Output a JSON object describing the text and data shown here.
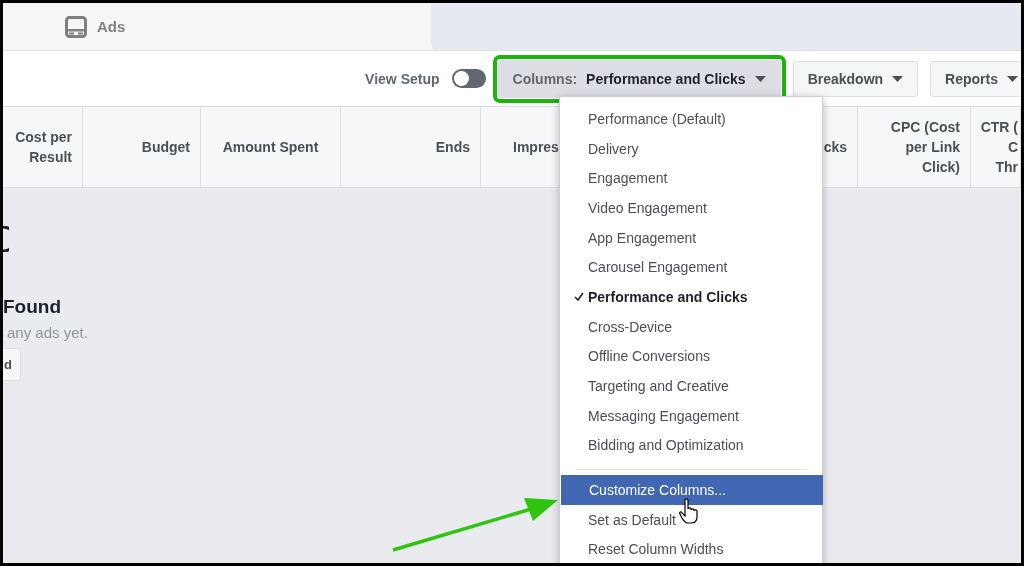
{
  "tab": {
    "label": "Ads"
  },
  "toolbar": {
    "view_setup": {
      "label": "View Setup",
      "on": false
    },
    "columns_button": {
      "label": "Columns: **Performance and Clicks**",
      "highlighted": true
    },
    "buttons": [
      "Breakdown",
      "Reports"
    ]
  },
  "table": {
    "columns": [
      {
        "label": "Cost per\nResult"
      },
      {
        "label": "Budget"
      },
      {
        "label": "Amount Spent"
      },
      {
        "label": "Ends"
      },
      {
        "label": "Impres"
      },
      {
        "label": "cks"
      },
      {
        "label": "CPC (Cost\nper Link\nClick)"
      },
      {
        "label": "CTR (\nC\nThr"
      }
    ]
  },
  "empty_state": {
    "title": "Found",
    "message": "any ads yet.",
    "button": "d"
  },
  "columns_menu": {
    "presets": [
      {
        "label": "Performance (Default)",
        "selected": false
      },
      {
        "label": "Delivery",
        "selected": false
      },
      {
        "label": "Engagement",
        "selected": false
      },
      {
        "label": "Video Engagement",
        "selected": false
      },
      {
        "label": "App Engagement",
        "selected": false
      },
      {
        "label": "Carousel Engagement",
        "selected": false
      },
      {
        "label": "Performance and Clicks",
        "selected": true
      },
      {
        "label": "Cross-Device",
        "selected": false
      },
      {
        "label": "Offline Conversions",
        "selected": false
      },
      {
        "label": "Targeting and Creative",
        "selected": false
      },
      {
        "label": "Messaging Engagement",
        "selected": false
      },
      {
        "label": "Bidding and Optimization",
        "selected": false
      }
    ],
    "actions": [
      {
        "label": "Customize Columns...",
        "hovered": true
      },
      {
        "label": "Set as Default",
        "hovered": false
      },
      {
        "label": "Reset Column Widths",
        "hovered": false
      }
    ]
  }
}
